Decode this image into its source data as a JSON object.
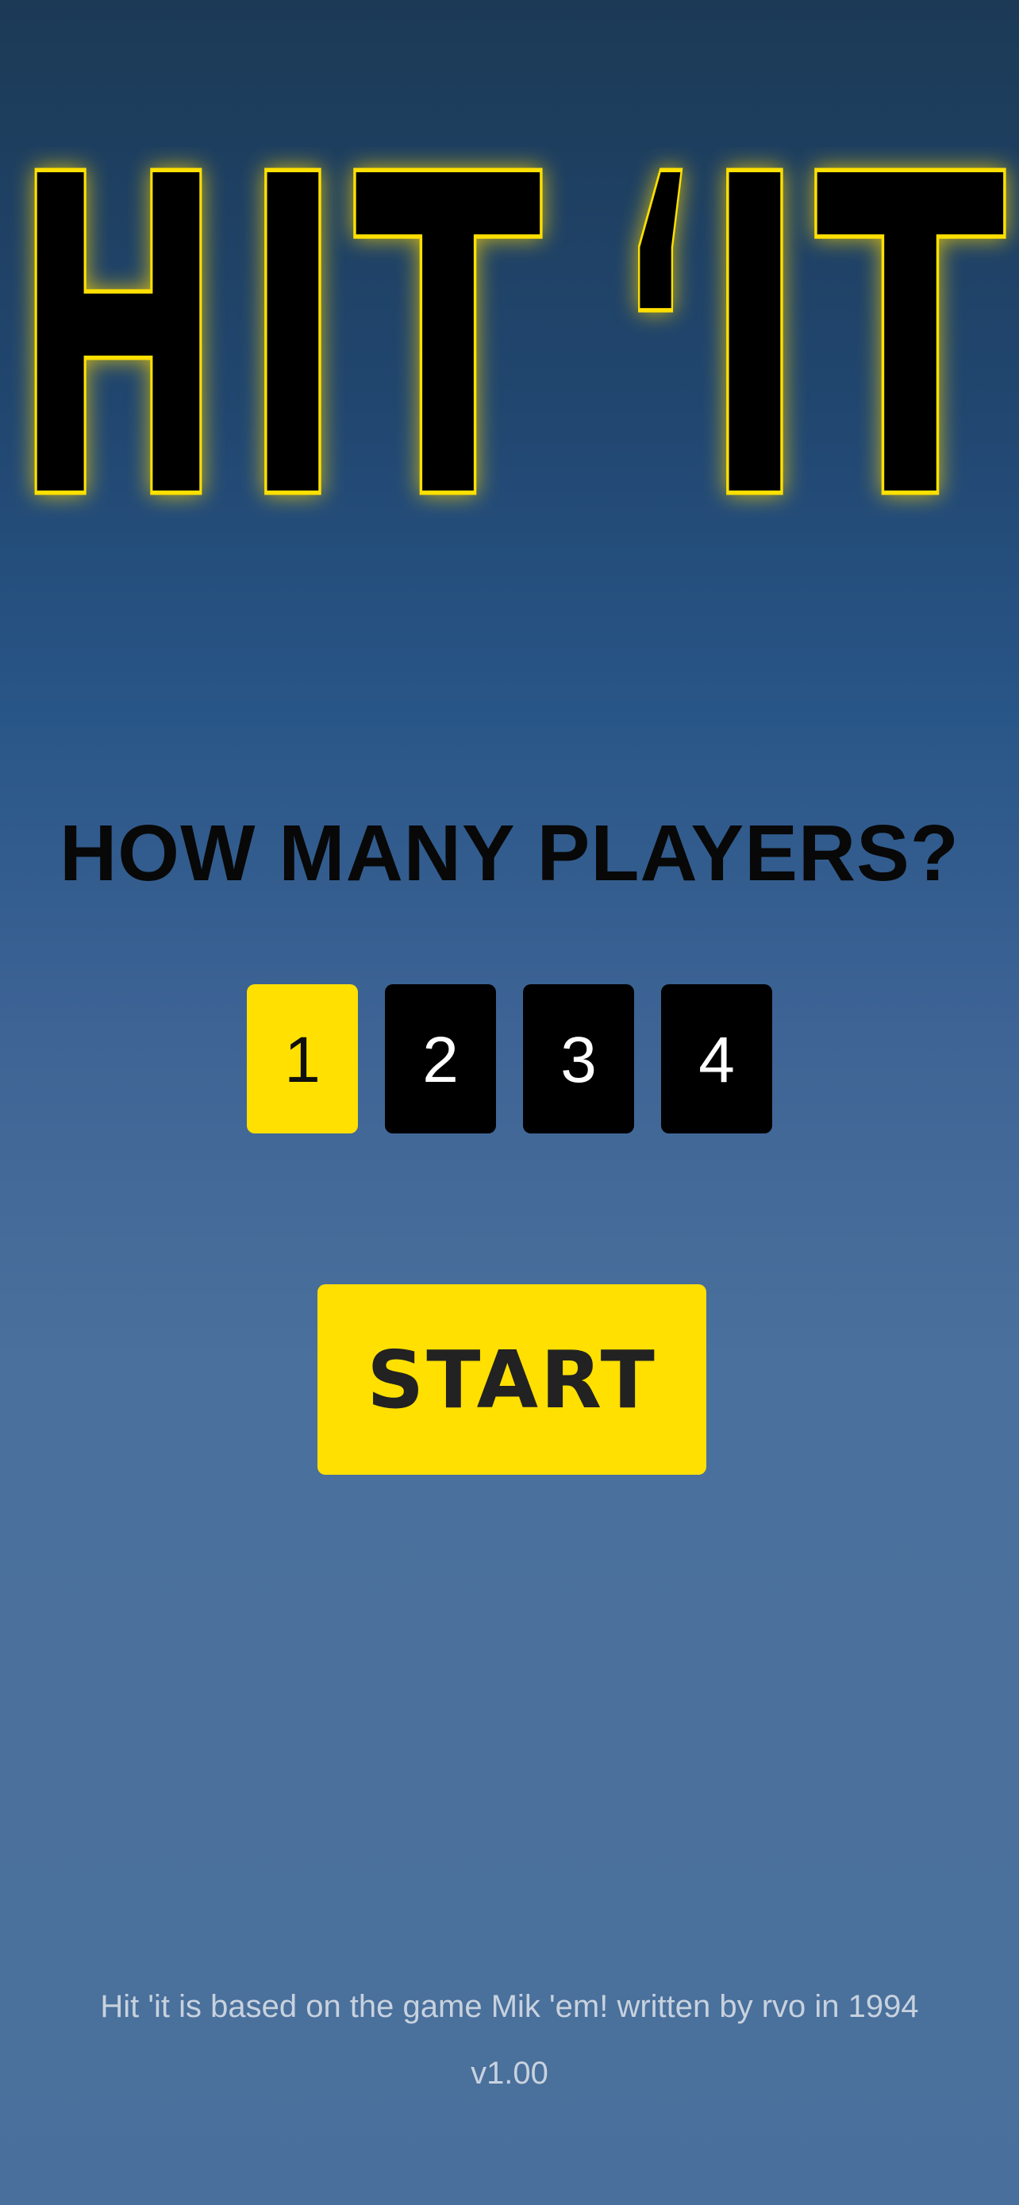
{
  "logo": {
    "text": "HIT 'IT",
    "letters": [
      "H",
      "I",
      "T",
      "‘",
      "I",
      "T"
    ]
  },
  "question": "HOW MANY PLAYERS?",
  "players": {
    "options": [
      "1",
      "2",
      "3",
      "4"
    ],
    "selected": "1"
  },
  "start_label": "START",
  "footer": {
    "credits": "Hit 'it is based on the game Mik 'em! written by rvo in 1994",
    "version": "v1.00"
  },
  "colors": {
    "accent": "#ffe000",
    "button_dark": "#000000",
    "text_dark": "#080808",
    "footer_text": "#c8d2de"
  }
}
